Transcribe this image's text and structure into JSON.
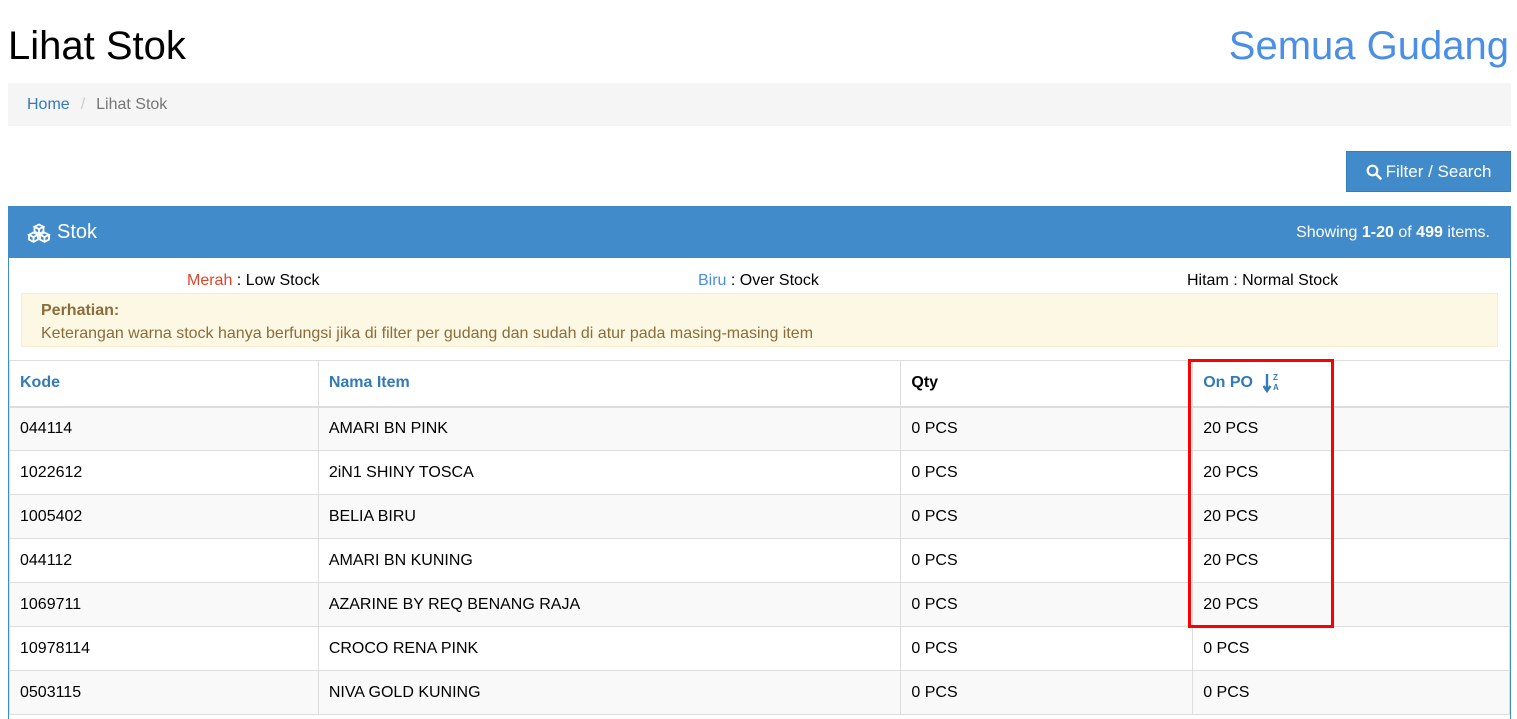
{
  "header": {
    "title": "Lihat Stok",
    "warehouse": "Semua Gudang"
  },
  "breadcrumb": {
    "home": "Home",
    "separator": "/",
    "current": "Lihat Stok"
  },
  "filter_button": {
    "label": "Filter / Search",
    "icon": "search-icon"
  },
  "panel": {
    "title": "Stok",
    "icon": "cubes-icon",
    "summary_prefix": "Showing ",
    "summary_range": "1-20",
    "summary_mid": " of ",
    "summary_total": "499",
    "summary_suffix": " items."
  },
  "legend": {
    "low_name": "Merah",
    "low_desc": " : Low Stock",
    "over_name": "Biru",
    "over_desc": " : Over Stock",
    "normal": "Hitam : Normal Stock"
  },
  "alert": {
    "title": "Perhatian:",
    "text": "Keterangan warna stock hanya berfungsi jika di filter per gudang dan sudah di atur pada masing-masing item"
  },
  "table": {
    "columns": [
      "Kode",
      "Nama Item",
      "Qty",
      "On PO"
    ],
    "sort_icon": "sort-alpha-desc-icon",
    "rows": [
      {
        "kode": "044114",
        "nama": "AMARI BN PINK",
        "qty": "0 PCS",
        "onpo": "20 PCS"
      },
      {
        "kode": "1022612",
        "nama": "2iN1 SHINY TOSCA",
        "qty": "0 PCS",
        "onpo": "20 PCS"
      },
      {
        "kode": "1005402",
        "nama": "BELIA BIRU",
        "qty": "0 PCS",
        "onpo": "20 PCS"
      },
      {
        "kode": "044112",
        "nama": "AMARI BN KUNING",
        "qty": "0 PCS",
        "onpo": "20 PCS"
      },
      {
        "kode": "1069711",
        "nama": "AZARINE BY REQ BENANG RAJA",
        "qty": "0 PCS",
        "onpo": "20 PCS"
      },
      {
        "kode": "10978114",
        "nama": "CROCO RENA PINK",
        "qty": "0 PCS",
        "onpo": "0 PCS"
      },
      {
        "kode": "0503115",
        "nama": "NIVA GOLD KUNING",
        "qty": "0 PCS",
        "onpo": "0 PCS"
      }
    ]
  },
  "colors": {
    "primary": "#428bca",
    "link": "#337ab7",
    "highlight": "#ff0000"
  }
}
